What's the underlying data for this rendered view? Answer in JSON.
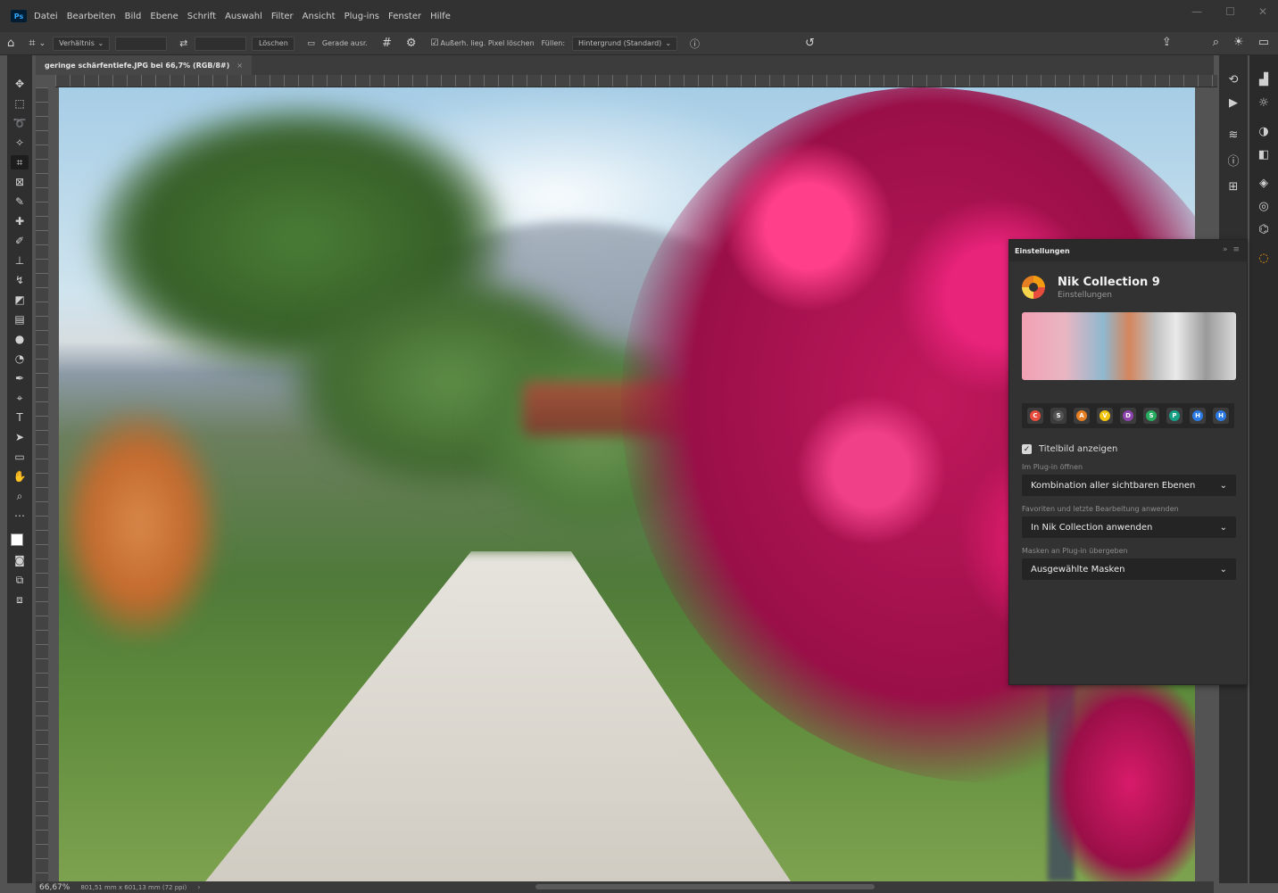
{
  "menu": {
    "logo": "Ps",
    "items": [
      "Datei",
      "Bearbeiten",
      "Bild",
      "Ebene",
      "Schrift",
      "Auswahl",
      "Filter",
      "Ansicht",
      "Plug-ins",
      "Fenster",
      "Hilfe"
    ]
  },
  "options": {
    "ratio_label": "Verhältnis",
    "clear_button": "Löschen",
    "straighten_label": "Gerade ausr.",
    "delete_cropped": "Außerh. lieg. Pixel löschen",
    "fill_label": "Füllen:",
    "fill_value": "Hintergrund (Standard)"
  },
  "document": {
    "tab_title": "geringe schärfentiefe.JPG bei 66,7% (RGB/8#)",
    "close": "×"
  },
  "status": {
    "zoom": "66,67%",
    "size": "801,51 mm x 601,13 mm (72 ppi)"
  },
  "panel": {
    "tab": "Einstellungen",
    "title": "Nik Collection 9",
    "subtitle": "Einstellungen",
    "plugins": [
      "C",
      "S",
      "A",
      "V",
      "D",
      "S",
      "P",
      "H",
      "H"
    ],
    "plugin_colors": [
      "#e74c3c",
      "#555555",
      "#e67e22",
      "#f1c40f",
      "#8e44ad",
      "#27ae60",
      "#16a085",
      "#2c7be5",
      "#2c7be5"
    ],
    "show_title_image": "Titelbild anzeigen",
    "open_in_plugin_label": "Im Plug-in öffnen",
    "open_in_plugin_value": "Kombination aller sichtbaren Ebenen",
    "favorites_label": "Favoriten und letzte Bearbeitung anwenden",
    "favorites_value": "In Nik Collection anwenden",
    "masks_label": "Masken an Plug-in übergeben",
    "masks_value": "Ausgewählte Masken"
  }
}
